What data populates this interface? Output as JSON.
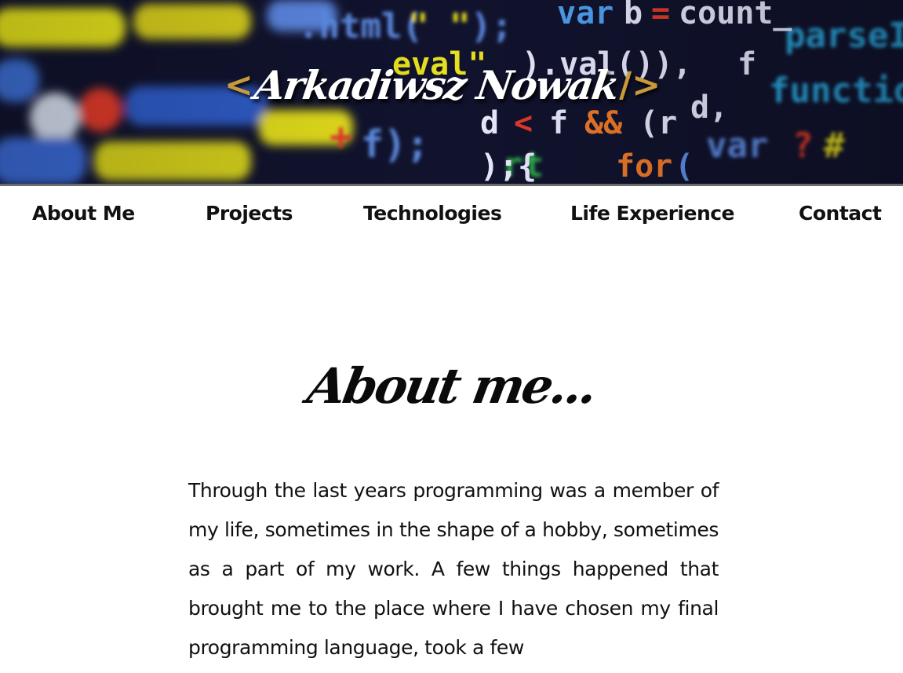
{
  "header": {
    "bracket_open": "<",
    "name": "Arkadiwsz Nowak",
    "bracket_close": "/>",
    "background_code_fragments": [
      "var b = count_",
      "html(\" \");",
      "val\").val()),",
      "f",
      "function",
      "d < f &&",
      "f);",
      "for (var",
      "{"
    ]
  },
  "nav": {
    "items": [
      {
        "label": "About Me"
      },
      {
        "label": "Projects"
      },
      {
        "label": "Technologies"
      },
      {
        "label": "Life Experience"
      },
      {
        "label": "Contact"
      }
    ]
  },
  "about": {
    "title": "About me...",
    "paragraph": "Through the last years programming was a member of my life, sometimes in the shape of a hobby, sometimes as a part of my work. A few things happened that brought me to the place where I have chosen my final programming language, took a few"
  },
  "colors": {
    "accent_bracket": "#c99a3a",
    "hero_bg": "#0d0f2a",
    "text": "#111111"
  }
}
